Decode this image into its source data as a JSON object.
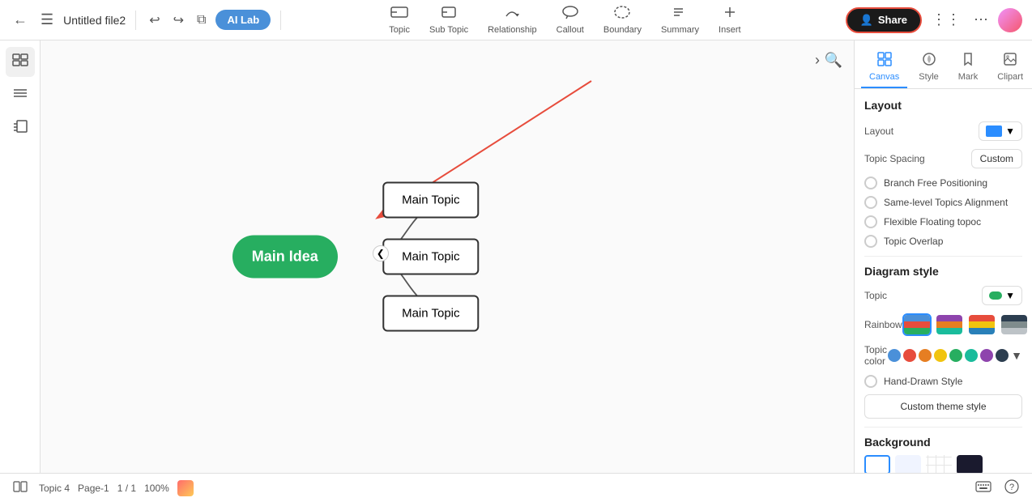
{
  "app": {
    "title": "Untitled file2"
  },
  "toolbar": {
    "back_label": "←",
    "menu_label": "☰",
    "undo_label": "↩",
    "redo_label": "↪",
    "clone_label": "⧉",
    "ai_lab_label": "AI Lab",
    "tools": [
      {
        "id": "topic",
        "icon": "⬜",
        "label": "Topic"
      },
      {
        "id": "subtopic",
        "icon": "⬜",
        "label": "Sub Topic"
      },
      {
        "id": "relationship",
        "icon": "↗",
        "label": "Relationship"
      },
      {
        "id": "callout",
        "icon": "💬",
        "label": "Callout"
      },
      {
        "id": "boundary",
        "icon": "⬭",
        "label": "Boundary"
      },
      {
        "id": "summary",
        "icon": "≡",
        "label": "Summary"
      },
      {
        "id": "insert",
        "icon": "+",
        "label": "Insert"
      }
    ],
    "share_label": "Share",
    "share_icon": "👤"
  },
  "left_sidebar": {
    "items": [
      {
        "id": "view-mode",
        "icon": "⊞"
      },
      {
        "id": "list-mode",
        "icon": "☰"
      },
      {
        "id": "outline-mode",
        "icon": "⊤"
      }
    ]
  },
  "mindmap": {
    "main_idea_label": "Main Idea",
    "topics": [
      {
        "id": "topic1",
        "label": "Main Topic"
      },
      {
        "id": "topic2",
        "label": "Main Topic"
      },
      {
        "id": "topic3",
        "label": "Main Topic"
      }
    ]
  },
  "right_panel": {
    "tabs": [
      {
        "id": "canvas",
        "icon": "⊞",
        "label": "Canvas",
        "active": true
      },
      {
        "id": "style",
        "icon": "🎨",
        "label": "Style"
      },
      {
        "id": "mark",
        "icon": "🔖",
        "label": "Mark"
      },
      {
        "id": "clipart",
        "icon": "🖼",
        "label": "Clipart"
      }
    ],
    "layout": {
      "section_title": "Layout",
      "layout_label": "Layout",
      "topic_spacing_label": "Topic Spacing",
      "topic_spacing_value": "Custom",
      "checkboxes": [
        {
          "id": "branch-free",
          "label": "Branch Free Positioning",
          "checked": false
        },
        {
          "id": "same-level",
          "label": "Same-level Topics Alignment",
          "checked": false
        },
        {
          "id": "flexible",
          "label": "Flexible Floating topoc",
          "checked": false
        },
        {
          "id": "overlap",
          "label": "Topic Overlap",
          "checked": false
        }
      ]
    },
    "diagram_style": {
      "section_title": "Diagram style",
      "topic_label": "Topic",
      "rainbow_label": "Rainbow",
      "topic_color_label": "Topic color",
      "colors": [
        "#4a90d9",
        "#e74c3c",
        "#e67e22",
        "#f1c40f",
        "#27ae60",
        "#1abc9c",
        "#8e44ad",
        "#2c3e50"
      ],
      "hand_drawn_label": "Hand-Drawn Style",
      "custom_theme_label": "Custom theme style"
    },
    "background": {
      "section_title": "Background"
    }
  },
  "bottom_bar": {
    "topic_count": "Topic 4",
    "page_info": "Page-1",
    "page_nav": "1 / 1",
    "zoom_level": "100%"
  }
}
